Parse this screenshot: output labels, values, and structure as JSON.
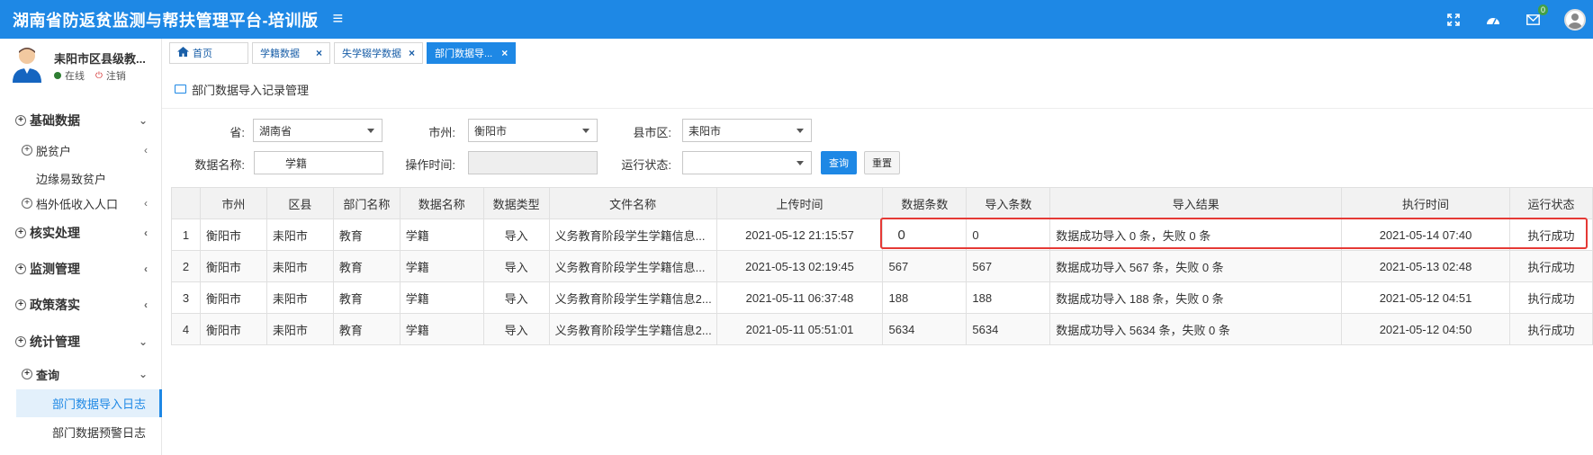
{
  "app": {
    "title": "湖南省防返贫监测与帮扶管理平台-培训版",
    "menu_icon": "hamburger-icon"
  },
  "top_icons": [
    {
      "name": "fullscreen-icon"
    },
    {
      "name": "dashboard-icon"
    },
    {
      "name": "mail-icon",
      "badge": "0"
    },
    {
      "name": "user-avatar-icon"
    }
  ],
  "user": {
    "name": "耒阳市区县级教...",
    "status": "在线",
    "logout": "注销"
  },
  "sidebar": {
    "items": [
      {
        "label": "基础数据",
        "arrow": "⌄"
      },
      {
        "label": "脱贫户",
        "arrow": "‹"
      },
      {
        "label": "边缘易致贫户"
      },
      {
        "label": "档外低收入人口",
        "arrow": "‹"
      },
      {
        "label": "核实处理",
        "arrow": "‹"
      },
      {
        "label": "监测管理",
        "arrow": "‹"
      },
      {
        "label": "政策落实",
        "arrow": "‹"
      },
      {
        "label": "统计管理",
        "arrow": "⌄"
      },
      {
        "label": "查询",
        "arrow": "⌄"
      },
      {
        "label": "部门数据导入日志"
      },
      {
        "label": "部门数据预警日志"
      }
    ]
  },
  "tabs": [
    {
      "label": "首页"
    },
    {
      "label": "学籍数据"
    },
    {
      "label": "失学辍学数据"
    },
    {
      "label": "部门数据导..."
    }
  ],
  "page": {
    "title": "部门数据导入记录管理"
  },
  "filters": {
    "province_label": "省:",
    "province_value": "湖南省",
    "city_label": "市州:",
    "city_value": "衡阳市",
    "county_label": "县市区:",
    "county_value": "耒阳市",
    "dataname_label": "数据名称:",
    "dataname_value": "学籍",
    "optime_label": "操作时间:",
    "optime_value": "",
    "runstate_label": "运行状态:",
    "runstate_value": "",
    "search_btn": "查询",
    "reset_btn": "重置"
  },
  "table": {
    "headers": [
      "",
      "市州",
      "区县",
      "部门名称",
      "数据名称",
      "数据类型",
      "文件名称",
      "上传时间",
      "数据条数",
      "导入条数",
      "导入结果",
      "执行时间",
      "运行状态"
    ],
    "rows": [
      [
        "1",
        "衡阳市",
        "耒阳市",
        "教育",
        "学籍",
        "导入",
        "义务教育阶段学生学籍信息...",
        "2021-05-12 21:15:57",
        "0",
        "0",
        "数据成功导入 0 条，失败 0 条",
        "2021-05-14 07:40",
        "执行成功"
      ],
      [
        "2",
        "衡阳市",
        "耒阳市",
        "教育",
        "学籍",
        "导入",
        "义务教育阶段学生学籍信息...",
        "2021-05-13 02:19:45",
        "567",
        "567",
        "数据成功导入 567 条，失败 0 条",
        "2021-05-13 02:48",
        "执行成功"
      ],
      [
        "3",
        "衡阳市",
        "耒阳市",
        "教育",
        "学籍",
        "导入",
        "义务教育阶段学生学籍信息2...",
        "2021-05-11 06:37:48",
        "188",
        "188",
        "数据成功导入 188 条，失败 0 条",
        "2021-05-12 04:51",
        "执行成功"
      ],
      [
        "4",
        "衡阳市",
        "耒阳市",
        "教育",
        "学籍",
        "导入",
        "义务教育阶段学生学籍信息2...",
        "2021-05-11 05:51:01",
        "5634",
        "5634",
        "数据成功导入 5634 条，失败 0 条",
        "2021-05-12 04:50",
        "执行成功"
      ]
    ]
  },
  "colors": {
    "primary": "#1e88e5",
    "highlight": "#e53935"
  }
}
